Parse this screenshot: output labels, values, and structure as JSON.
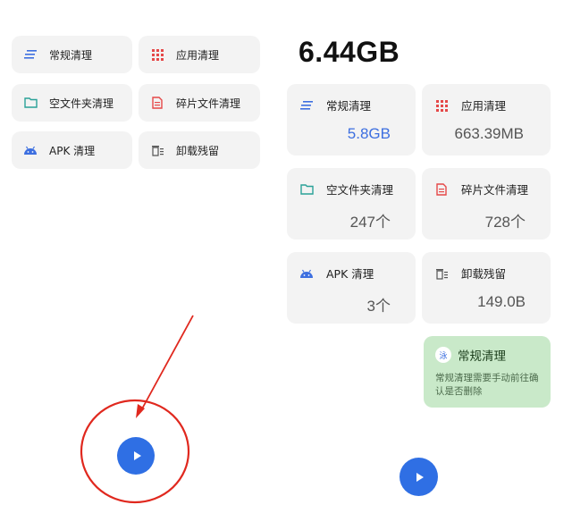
{
  "left_panel": {
    "items": [
      {
        "label": "常规清理",
        "icon": "lines-icon"
      },
      {
        "label": "应用清理",
        "icon": "app-grid-icon"
      },
      {
        "label": "空文件夹清理",
        "icon": "folder-icon"
      },
      {
        "label": "碎片文件清理",
        "icon": "document-icon"
      },
      {
        "label": "APK 清理",
        "icon": "android-icon"
      },
      {
        "label": "卸载残留",
        "icon": "trash-icon"
      }
    ]
  },
  "right_panel": {
    "total": "6.44GB",
    "items": [
      {
        "label": "常规清理",
        "value": "5.8GB",
        "icon": "lines-icon"
      },
      {
        "label": "应用清理",
        "value": "663.39MB",
        "icon": "app-grid-icon"
      },
      {
        "label": "空文件夹清理",
        "value": "247个",
        "icon": "folder-icon"
      },
      {
        "label": "碎片文件清理",
        "value": "728个",
        "icon": "document-icon"
      },
      {
        "label": "APK 清理",
        "value": "3个",
        "icon": "android-icon"
      },
      {
        "label": "卸载残留",
        "value": "149.0B",
        "icon": "trash-icon"
      }
    ],
    "tip": {
      "title": "常规清理",
      "text": "常规清理需要手动前往确认是否删除",
      "icon_char": "泳"
    }
  },
  "colors": {
    "card_bg": "#f3f3f3",
    "accent_blue": "#2f6fe4",
    "value_blue": "#3d6fe0",
    "tip_bg": "#c9e9c9",
    "annotation_red": "#e0281e"
  }
}
